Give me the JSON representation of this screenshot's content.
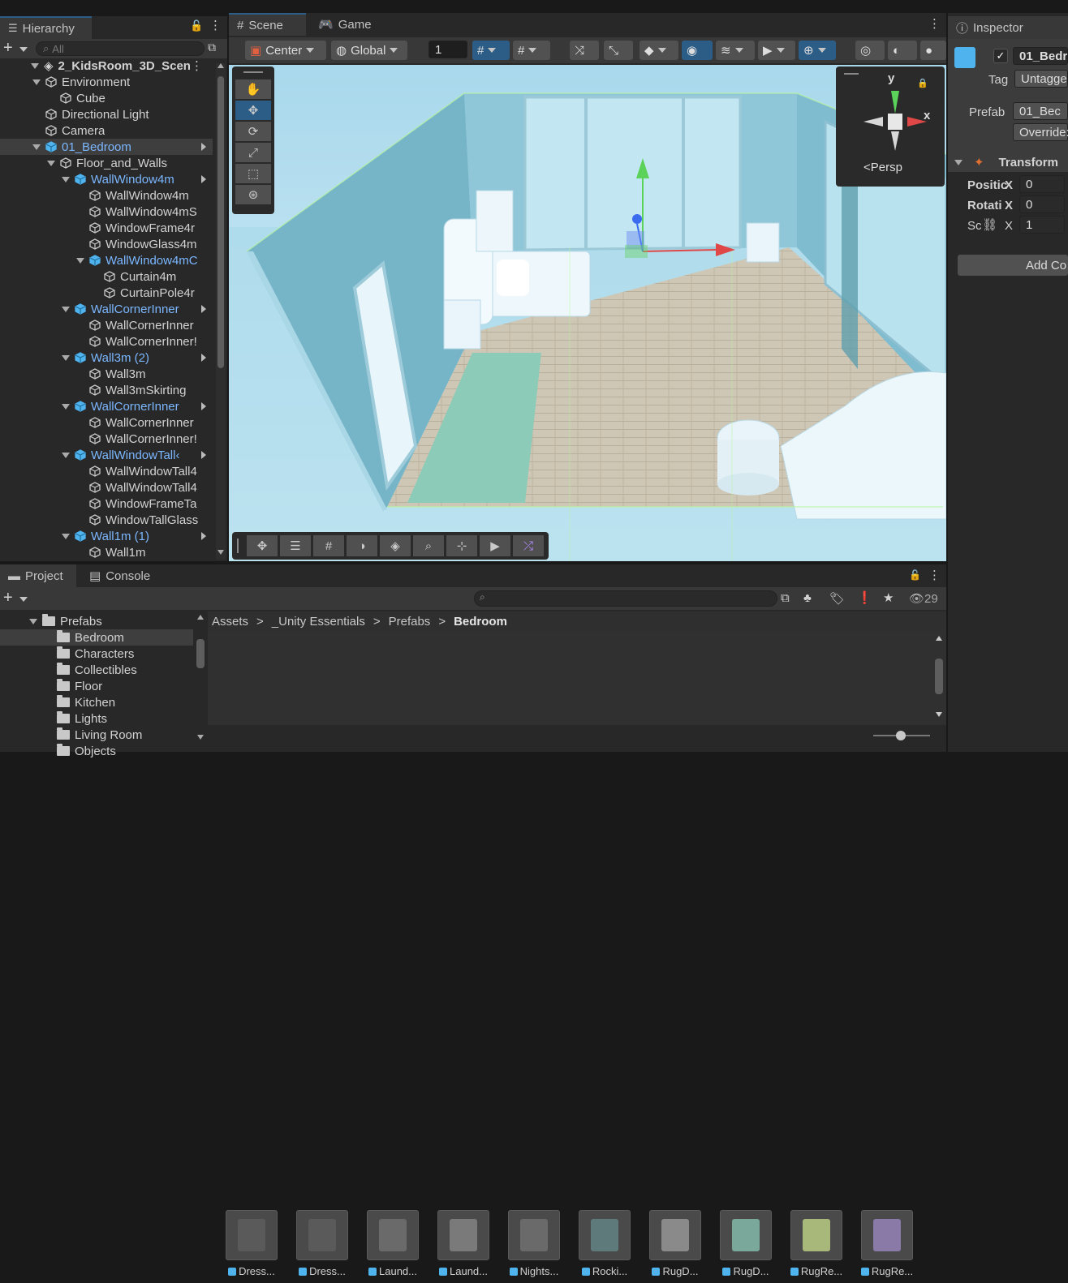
{
  "hierarchy": {
    "title": "Hierarchy",
    "search_placeholder": "All",
    "root": "2_KidsRoom_3D_Scen",
    "items": [
      {
        "label": "Environment",
        "depth": 1,
        "expanded": true,
        "prefab": false
      },
      {
        "label": "Cube",
        "depth": 2,
        "prefab": false
      },
      {
        "label": "Directional Light",
        "depth": 1,
        "prefab": false
      },
      {
        "label": "Camera",
        "depth": 1,
        "prefab": false
      },
      {
        "label": "01_Bedroom",
        "depth": 1,
        "expanded": true,
        "prefab": true,
        "selected": true,
        "more": true
      },
      {
        "label": "Floor_and_Walls",
        "depth": 2,
        "expanded": true,
        "prefab": false
      },
      {
        "label": "WallWindow4m",
        "depth": 3,
        "expanded": true,
        "prefab": true,
        "more": true
      },
      {
        "label": "WallWindow4m",
        "depth": 4,
        "prefab": false
      },
      {
        "label": "WallWindow4mS",
        "depth": 4,
        "prefab": false
      },
      {
        "label": "WindowFrame4r",
        "depth": 4,
        "prefab": false
      },
      {
        "label": "WindowGlass4m",
        "depth": 4,
        "prefab": false
      },
      {
        "label": "WallWindow4mC",
        "depth": 4,
        "expanded": true,
        "prefab": true
      },
      {
        "label": "Curtain4m",
        "depth": 5,
        "prefab": false
      },
      {
        "label": "CurtainPole4r",
        "depth": 5,
        "prefab": false
      },
      {
        "label": "WallCornerInner",
        "depth": 3,
        "expanded": true,
        "prefab": true,
        "more": true
      },
      {
        "label": "WallCornerInner",
        "depth": 4,
        "prefab": false
      },
      {
        "label": "WallCornerInner!",
        "depth": 4,
        "prefab": false
      },
      {
        "label": "Wall3m (2)",
        "depth": 3,
        "expanded": true,
        "prefab": true,
        "more": true
      },
      {
        "label": "Wall3m",
        "depth": 4,
        "prefab": false
      },
      {
        "label": "Wall3mSkirting",
        "depth": 4,
        "prefab": false
      },
      {
        "label": "WallCornerInner",
        "depth": 3,
        "expanded": true,
        "prefab": true,
        "more": true
      },
      {
        "label": "WallCornerInner",
        "depth": 4,
        "prefab": false
      },
      {
        "label": "WallCornerInner!",
        "depth": 4,
        "prefab": false
      },
      {
        "label": "WallWindowTall‹",
        "depth": 3,
        "expanded": true,
        "prefab": true,
        "more": true
      },
      {
        "label": "WallWindowTall4",
        "depth": 4,
        "prefab": false
      },
      {
        "label": "WallWindowTall4",
        "depth": 4,
        "prefab": false
      },
      {
        "label": "WindowFrameTa",
        "depth": 4,
        "prefab": false
      },
      {
        "label": "WindowTallGlass",
        "depth": 4,
        "prefab": false
      },
      {
        "label": "Wall1m (1)",
        "depth": 3,
        "expanded": true,
        "prefab": true,
        "more": true
      },
      {
        "label": "Wall1m",
        "depth": 4,
        "prefab": false
      }
    ]
  },
  "scene": {
    "tab_scene": "Scene",
    "tab_game": "Game",
    "pivot": "Center",
    "space": "Global",
    "grid_value": "1",
    "persp": "Persp",
    "axis_y": "y",
    "axis_x": "x"
  },
  "inspector": {
    "title": "Inspector",
    "object_name": "01_Bedr",
    "tag_label": "Tag",
    "tag_value": "Untagge",
    "prefab_label": "Prefab",
    "prefab_value": "01_Bec",
    "overrides": "Override:",
    "transform": "Transform",
    "position_label": "Positic",
    "rotation_label": "Rotati",
    "scale_label": "Sc",
    "x": "X",
    "pos_x": "0",
    "rot_x": "0",
    "scale_x": "1",
    "add_component": "Add Co"
  },
  "project": {
    "tab_project": "Project",
    "tab_console": "Console",
    "count": "29",
    "folders": [
      {
        "label": "Prefabs",
        "depth": 1,
        "expanded": true
      },
      {
        "label": "Bedroom",
        "depth": 2,
        "selected": true
      },
      {
        "label": "Characters",
        "depth": 2
      },
      {
        "label": "Collectibles",
        "depth": 2
      },
      {
        "label": "Floor",
        "depth": 2
      },
      {
        "label": "Kitchen",
        "depth": 2
      },
      {
        "label": "Lights",
        "depth": 2
      },
      {
        "label": "Living Room",
        "depth": 2
      },
      {
        "label": "Objects",
        "depth": 2
      }
    ],
    "breadcrumb": [
      "Assets",
      "_Unity Essentials",
      "Prefabs",
      "Bedroom"
    ],
    "assets": [
      "Dress...",
      "Dress...",
      "Laund...",
      "Laund...",
      "Nights...",
      "Rocki...",
      "RugD...",
      "RugD...",
      "RugRe...",
      "RugRe..."
    ]
  },
  "colors": {
    "accent": "#2c5d87",
    "prefab": "#7bb7ff",
    "selection": "#2c5d87"
  }
}
